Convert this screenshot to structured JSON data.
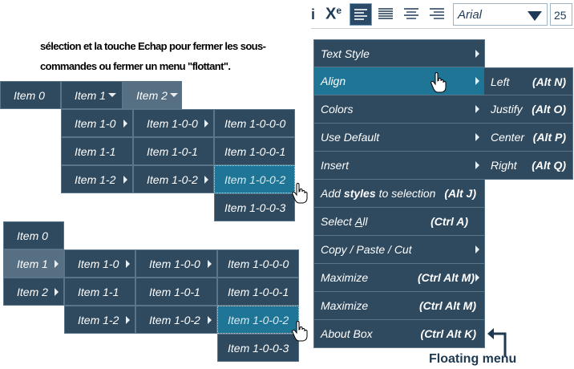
{
  "toolbar": {
    "i_label": "i",
    "superscript_label": "X",
    "superscript_exp": "e",
    "font": "Arial",
    "size": "25"
  },
  "paragraph": {
    "line1_pre": "sélection et la touche ",
    "line1_bold": "Echap",
    "line1_post": " pour fermer les sous-",
    "line2_pre": "commandes ou fermer un menu ",
    "line2_bold": "\"flottant\"",
    "line2_post": "."
  },
  "menu1": {
    "top": [
      "Item 0",
      "Item 1",
      "Item 2"
    ],
    "col1": [
      "Item 1-0",
      "Item 1-1",
      "Item 1-2"
    ],
    "col2": [
      "Item 1-0-0",
      "Item 1-0-1",
      "Item 1-0-2"
    ],
    "col3": [
      "Item 1-0-0-0",
      "Item 1-0-0-1",
      "Item 1-0-0-2",
      "Item 1-0-0-3"
    ]
  },
  "menu2": {
    "col0": [
      "Item 0",
      "Item 1",
      "Item 2"
    ],
    "col1": [
      "Item 1-0",
      "Item 1-1",
      "Item 1-2"
    ],
    "col2": [
      "Item 1-0-0",
      "Item 1-0-1",
      "Item 1-0-2"
    ],
    "col3": [
      "Item 1-0-0-0",
      "Item 1-0-0-1",
      "Item 1-0-0-2",
      "Item 1-0-0-3"
    ]
  },
  "floating_menu": {
    "items": [
      {
        "label": "Text Style"
      },
      {
        "label": "Align"
      },
      {
        "label": "Colors"
      },
      {
        "label": "Use Default"
      },
      {
        "label": "Insert"
      },
      {
        "label_pre": "Add ",
        "label_bold": "styles",
        "label_post": " to selection",
        "shortcut": "(Alt J)"
      },
      {
        "label_pre": "Select ",
        "label_u": "A",
        "label_post": "ll",
        "shortcut": "(Ctrl A)"
      },
      {
        "label": "Copy / Paste / Cut"
      },
      {
        "label": "Maximize",
        "shortcut": "(Ctrl Alt M)"
      },
      {
        "label": "Maximize",
        "shortcut": "(Ctrl Alt M)"
      },
      {
        "label": "About Box",
        "shortcut": "(Ctrl Alt K)"
      }
    ],
    "align_submenu": [
      {
        "label": "Left",
        "shortcut": "(Alt N)"
      },
      {
        "label": "Justify",
        "shortcut": "(Alt O)"
      },
      {
        "label": "Center",
        "shortcut": "(Alt P)"
      },
      {
        "label": "Right",
        "shortcut": "(Alt Q)"
      }
    ],
    "caption": "Floating menu"
  },
  "colors": {
    "menu_bg": "#2f4a5f",
    "menu_light": "#566f82",
    "highlight": "#1f7596",
    "caption": "#1d3a52"
  }
}
